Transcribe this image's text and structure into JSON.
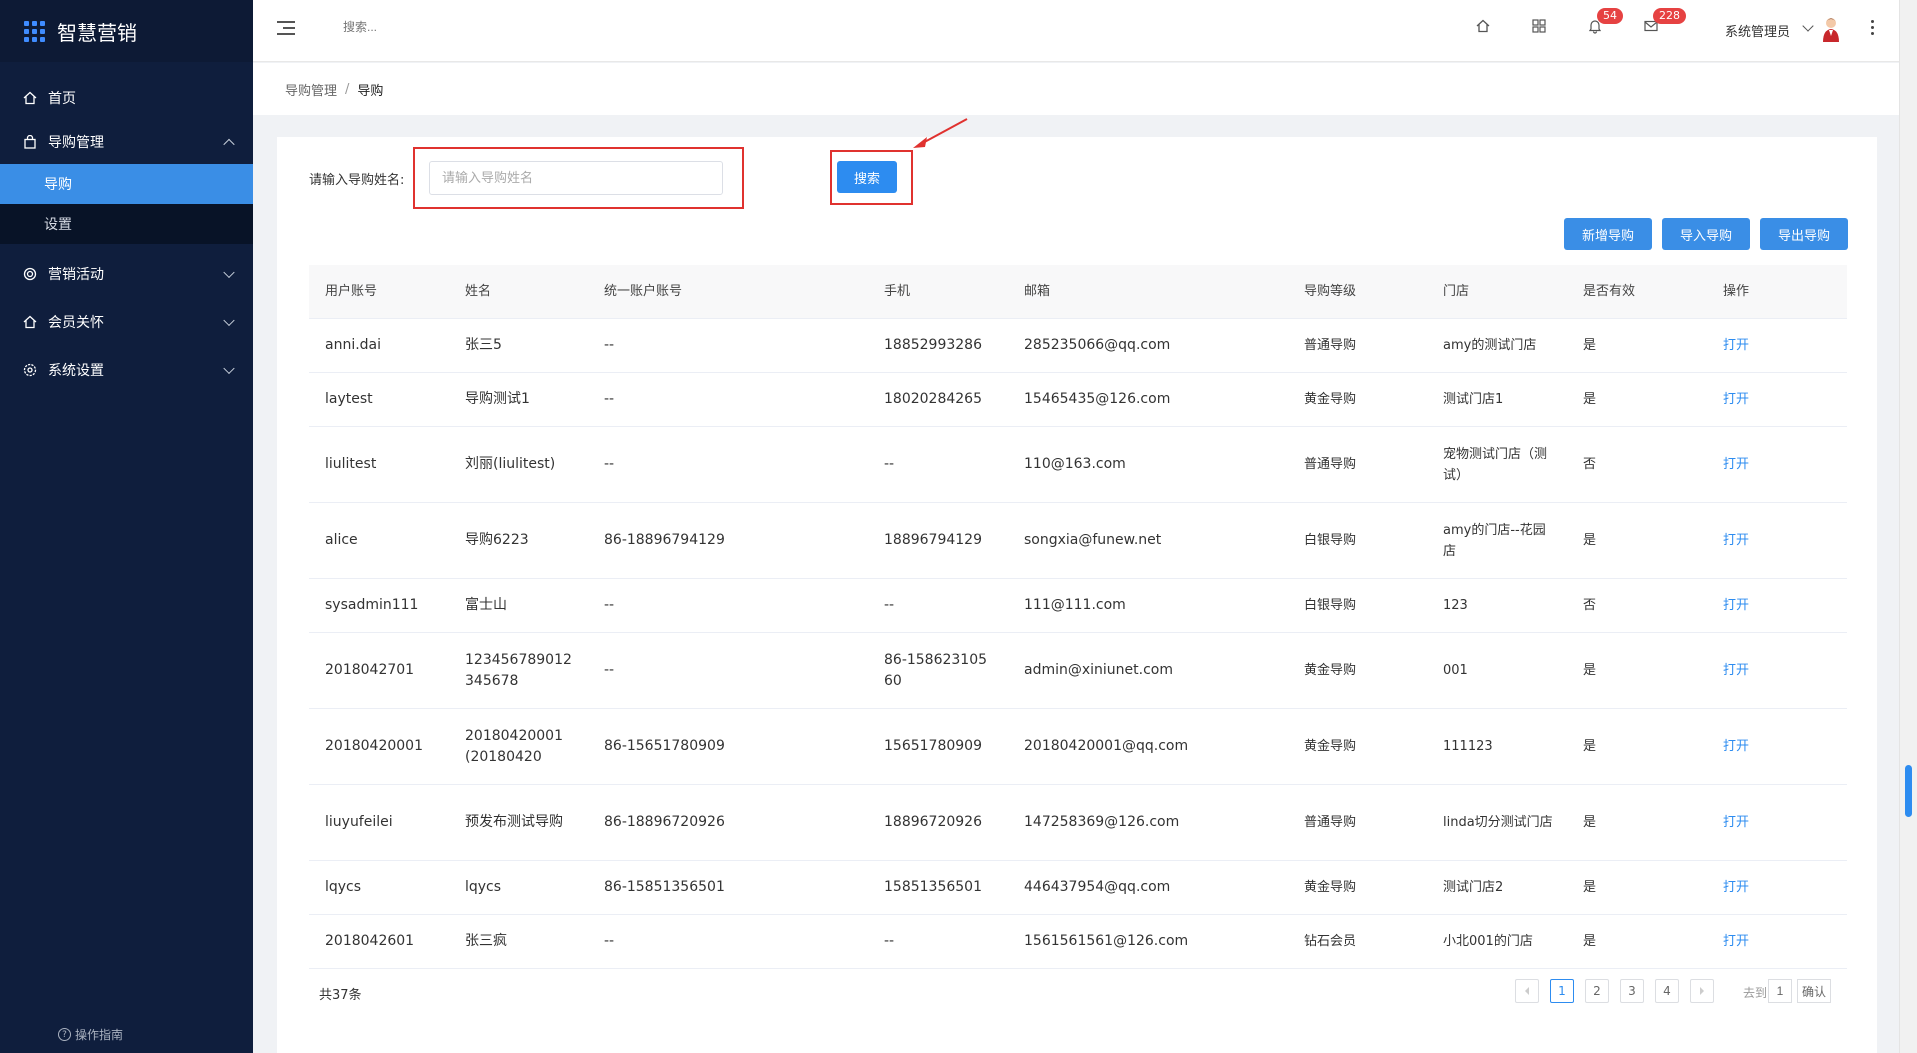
{
  "app": {
    "title": "智慧营销"
  },
  "sidebar": {
    "home": "首页",
    "guide_mgmt": "导购管理",
    "sub": [
      "导购",
      "设置"
    ],
    "marketing": "营销活动",
    "member_care": "会员关怀",
    "system": "系统设置",
    "help": "操作指南"
  },
  "header": {
    "search_placeholder": "搜索...",
    "notify_count": "54",
    "message_count": "228",
    "user": "系统管理员"
  },
  "breadcrumb": {
    "parent": "导购管理",
    "current": "导购"
  },
  "search": {
    "label": "请输入导购姓名:",
    "placeholder": "请输入导购姓名",
    "button": "搜索"
  },
  "actions": {
    "add": "新增导购",
    "import": "导入导购",
    "export": "导出导购"
  },
  "table": {
    "columns": [
      "用户账号",
      "姓名",
      "统一账户账号",
      "手机",
      "邮箱",
      "导购等级",
      "门店",
      "是否有效",
      "操作"
    ],
    "rows": [
      [
        "anni.dai",
        "张三5",
        "--",
        "18852993286",
        "285235066@qq.com",
        "普通导购",
        "amy的测试门店",
        "是",
        "打开"
      ],
      [
        "laytest",
        "导购测试1",
        "--",
        "18020284265",
        "15465435@126.com",
        "黄金导购",
        "测试门店1",
        "是",
        "打开"
      ],
      [
        "liulitest",
        "刘丽(liulitest)",
        "--",
        "--",
        "110@163.com",
        "普通导购",
        "宠物测试门店（测试）",
        "否",
        "打开"
      ],
      [
        "alice",
        "导购6223",
        "86-18896794129",
        "18896794129",
        "songxia@funew.net",
        "白银导购",
        "amy的门店--花园店",
        "是",
        "打开"
      ],
      [
        "sysadmin111",
        "富士山",
        "--",
        "--",
        "111@111.com",
        "白银导购",
        "123",
        "否",
        "打开"
      ],
      [
        "2018042701",
        "123456789012345678",
        "--",
        "86-15862310560",
        "admin@xiniunet.com",
        "黄金导购",
        "001",
        "是",
        "打开"
      ],
      [
        "20180420001",
        "20180420001(20180420",
        "86-15651780909",
        "15651780909",
        "20180420001@qq.com",
        "黄金导购",
        "111123",
        "是",
        "打开"
      ],
      [
        "liuyufeilei",
        "预发布测试导购",
        "86-18896720926",
        "18896720926",
        "147258369@126.com",
        "普通导购",
        "linda切分测试门店",
        "是",
        "打开"
      ],
      [
        "lqycs",
        "lqycs",
        "86-15851356501",
        "15851356501",
        "446437954@qq.com",
        "黄金导购",
        "测试门店2",
        "是",
        "打开"
      ],
      [
        "2018042601",
        "张三疯",
        "--",
        "--",
        "1561561561@126.com",
        "钻石会员",
        "小北001的门店",
        "是",
        "打开"
      ]
    ]
  },
  "pagination": {
    "total": "共37条",
    "pages": [
      "1",
      "2",
      "3",
      "4"
    ],
    "current": "1",
    "goto_label": "去到",
    "goto_value": "1",
    "confirm": "确认"
  },
  "colors": {
    "sidebar_bg": "#0f1e3d",
    "accent": "#2d8cf0",
    "highlight": "#e0322f"
  }
}
